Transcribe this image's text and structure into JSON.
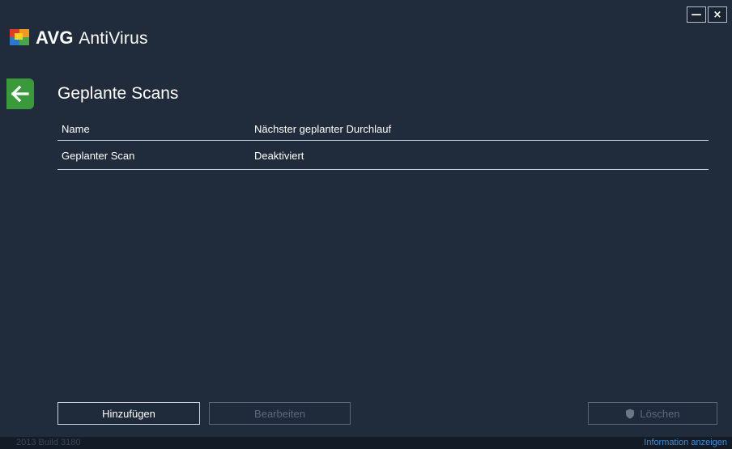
{
  "app": {
    "brand": "AVG",
    "product": "AntiVirus"
  },
  "window_buttons": {
    "minimize": "—",
    "close": "×"
  },
  "page": {
    "title": "Geplante Scans"
  },
  "table": {
    "headers": [
      "Name",
      "Nächster geplanter Durchlauf"
    ],
    "rows": [
      [
        "Geplanter Scan",
        "Deaktiviert"
      ]
    ]
  },
  "buttons": {
    "add": "Hinzufügen",
    "edit": "Bearbeiten",
    "delete": "Löschen"
  },
  "footer": {
    "build": "2013  Build 3180",
    "info": "Information anzeigen"
  },
  "colors": {
    "background": "#202b3b",
    "back_button": "#3a9a3a",
    "link": "#3b8ed6",
    "logo_red": "#e23a2a",
    "logo_orange": "#f29a1f",
    "logo_yellow": "#f7d21f",
    "logo_blue": "#2c78c8",
    "logo_green": "#4aa44a"
  },
  "icons": {
    "back": "arrow-left-icon",
    "delete": "shield-icon"
  }
}
